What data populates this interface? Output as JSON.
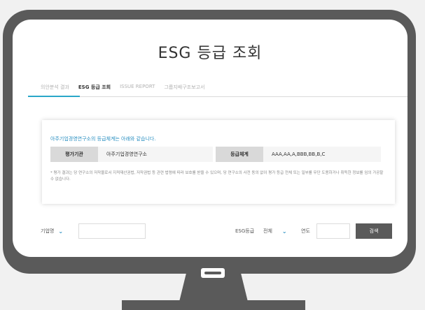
{
  "page": {
    "title": "ESG 등급 조회"
  },
  "tabs": [
    {
      "label": "의안분석 결과",
      "active": false
    },
    {
      "label": "ESG 등급 조회",
      "active": true
    },
    {
      "label": "ISSUE REPORT",
      "active": false
    },
    {
      "label": "그룹지배구조보고서",
      "active": false
    }
  ],
  "info": {
    "heading": "아주기업경영연구소의 등급체계는 아래와 같습니다.",
    "evaluator_label": "평가기관",
    "evaluator_value": "아주기업경영연구소",
    "grade_label": "등급체계",
    "grade_value": "AAA,AA,A,BBB,BB,B,C",
    "note": "* 평가 결과는 당 연구소의 저작물로서 지적재산권법, 저작권법 등 관련 법령에 따라 보호를 받을 수 있으며, 당 연구소의 사전 동의 없이 평가 등급 전체 또는 일부를 무단 도용하거나 취득한 정보를 임의 가공할 수 없습니다."
  },
  "search": {
    "company_select": "기업명",
    "esg_label": "ESG등급",
    "esg_select": "전체",
    "year_label": "연도",
    "button_label": "검색"
  },
  "colors": {
    "accent": "#2aa7c9",
    "frame": "#5a5a5a"
  }
}
